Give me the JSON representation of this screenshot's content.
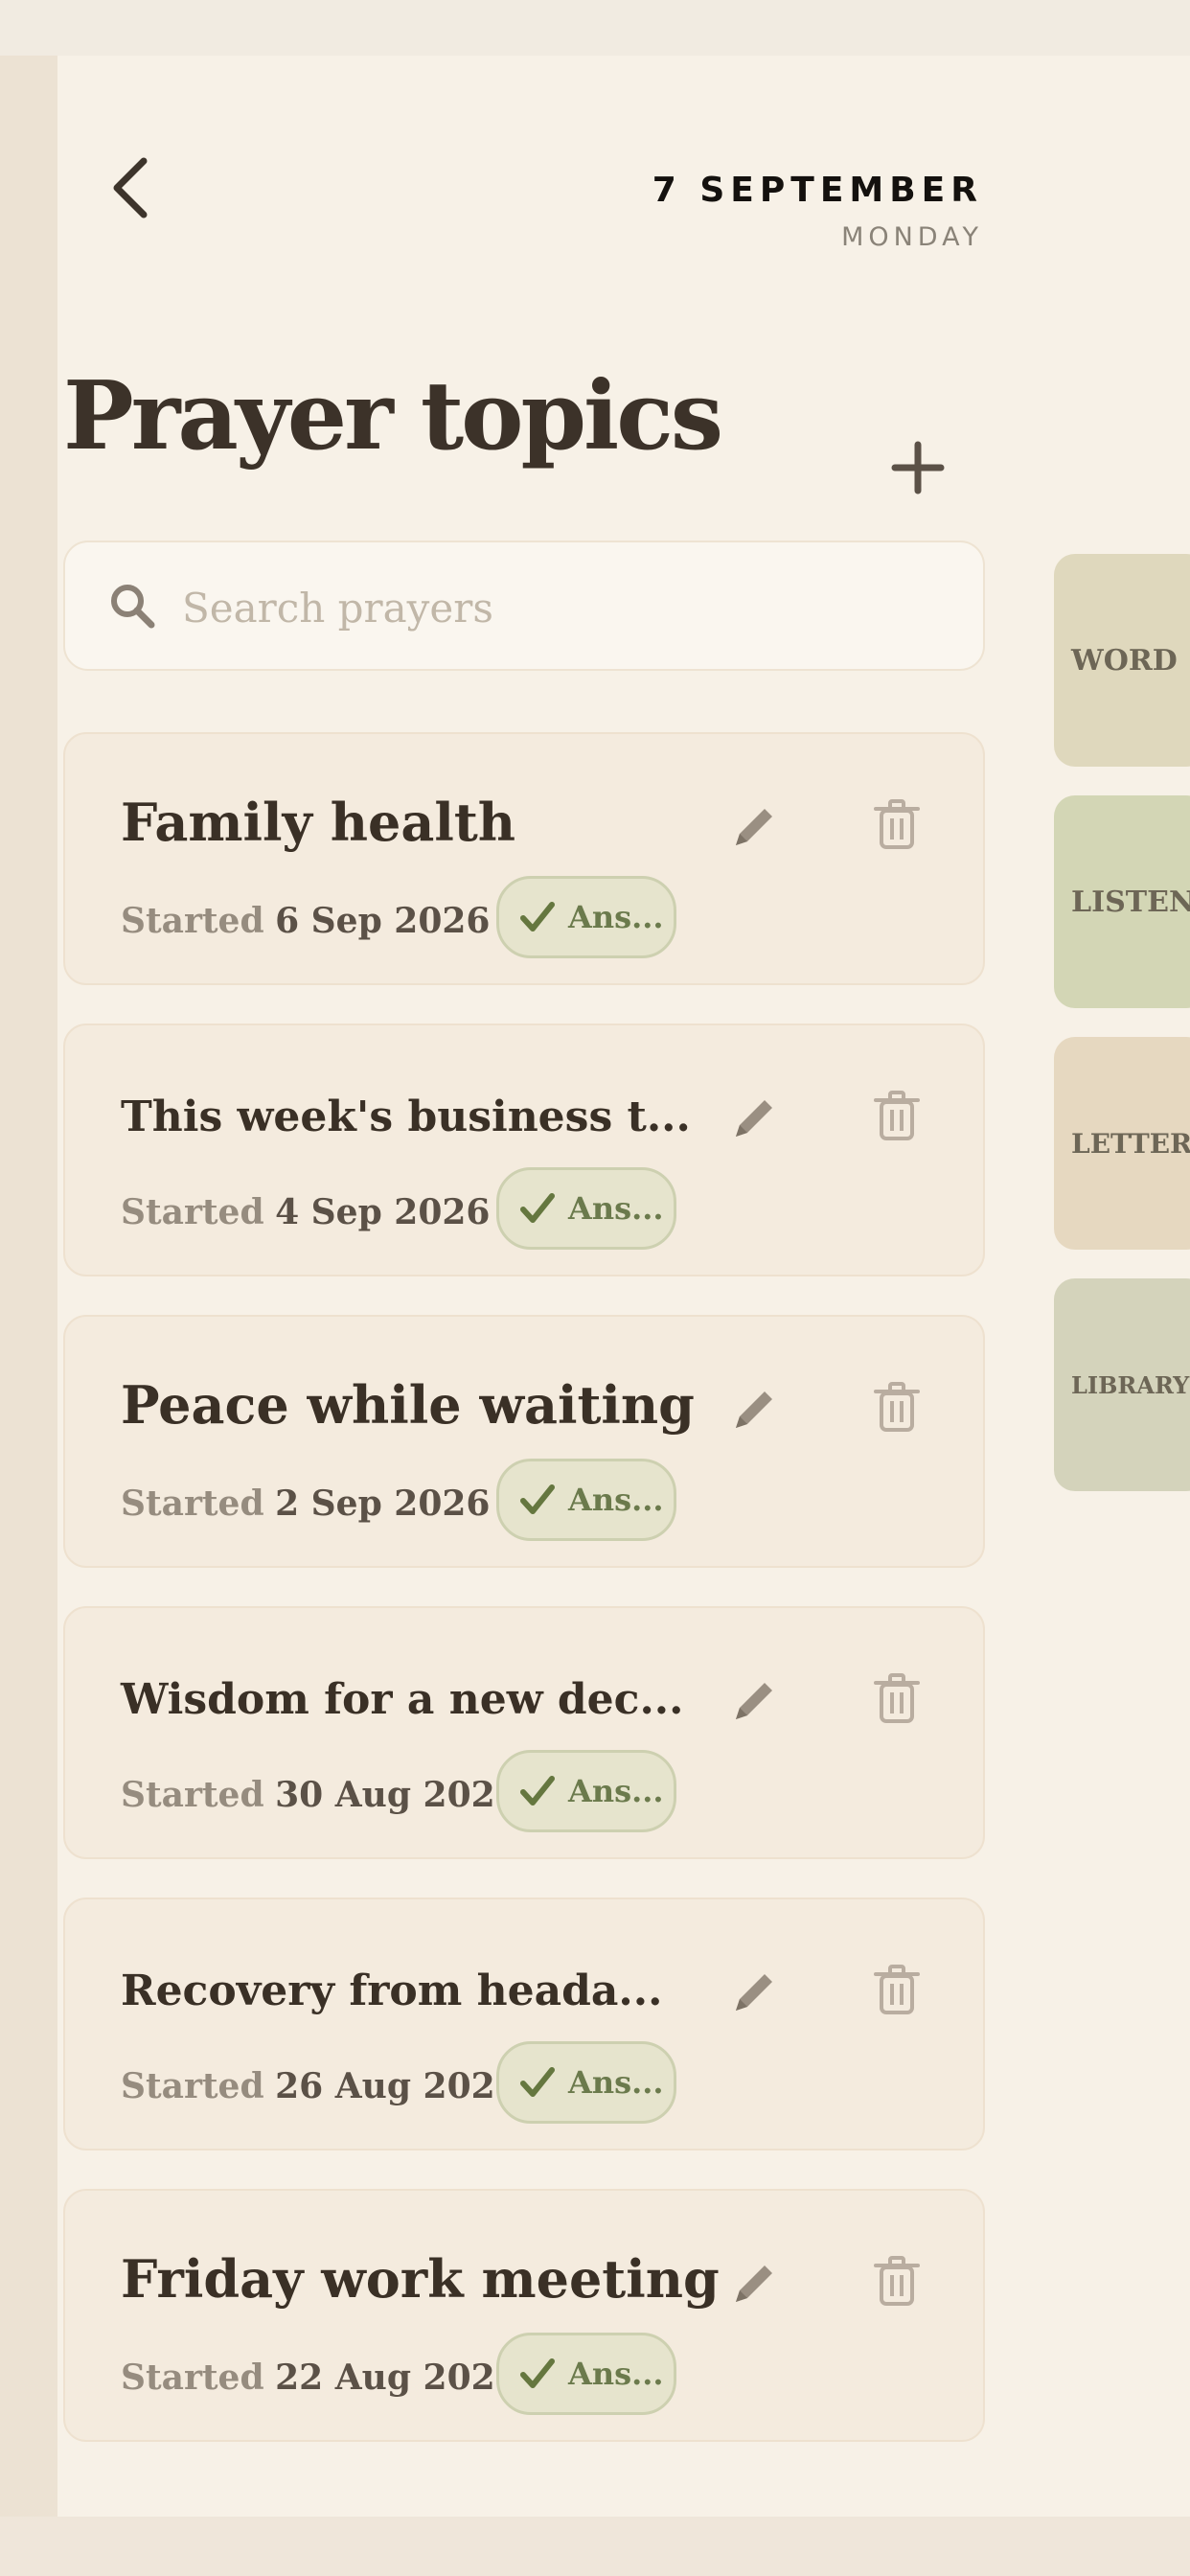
{
  "header": {
    "date_main": "7 SEPTEMBER",
    "date_sub": "MONDAY"
  },
  "page_title": "Prayer topics",
  "search": {
    "placeholder": "Search prayers",
    "value": ""
  },
  "started_label": "Started",
  "prayers": [
    {
      "title": "Family health",
      "date": "6 Sep 2026",
      "status": "Ans..."
    },
    {
      "title": "This week's business t...",
      "date": "4 Sep 2026",
      "status": "Ans..."
    },
    {
      "title": "Peace while waiting",
      "date": "2 Sep 2026",
      "status": "Ans..."
    },
    {
      "title": "Wisdom for a new dec...",
      "date": "30 Aug 2026",
      "status": "Ans..."
    },
    {
      "title": "Recovery from heada...",
      "date": "26 Aug 2026",
      "status": "Ans..."
    },
    {
      "title": "Friday work meeting",
      "date": "22 Aug 2026",
      "status": "Ans..."
    }
  ],
  "side_tabs": [
    {
      "label": "WORD"
    },
    {
      "label": "LISTEN"
    },
    {
      "label": "LETTER"
    },
    {
      "label": "LIBRARY"
    }
  ],
  "icons": {
    "back": "chevron-left-icon",
    "add": "plus-icon",
    "search": "search-icon",
    "edit": "pencil-icon",
    "delete": "trash-icon",
    "answered": "check-icon"
  },
  "colors": {
    "background": "#f7f1e7",
    "card": "#f4ebde",
    "title_text": "#3c3229",
    "badge_bg": "#e6e4cd",
    "badge_text": "#6b7a4c",
    "tab_word": "#dfd8bd",
    "tab_listen": "#d3d6b5",
    "tab_letter": "#e6d8c0",
    "tab_library": "#d4d3bb"
  }
}
